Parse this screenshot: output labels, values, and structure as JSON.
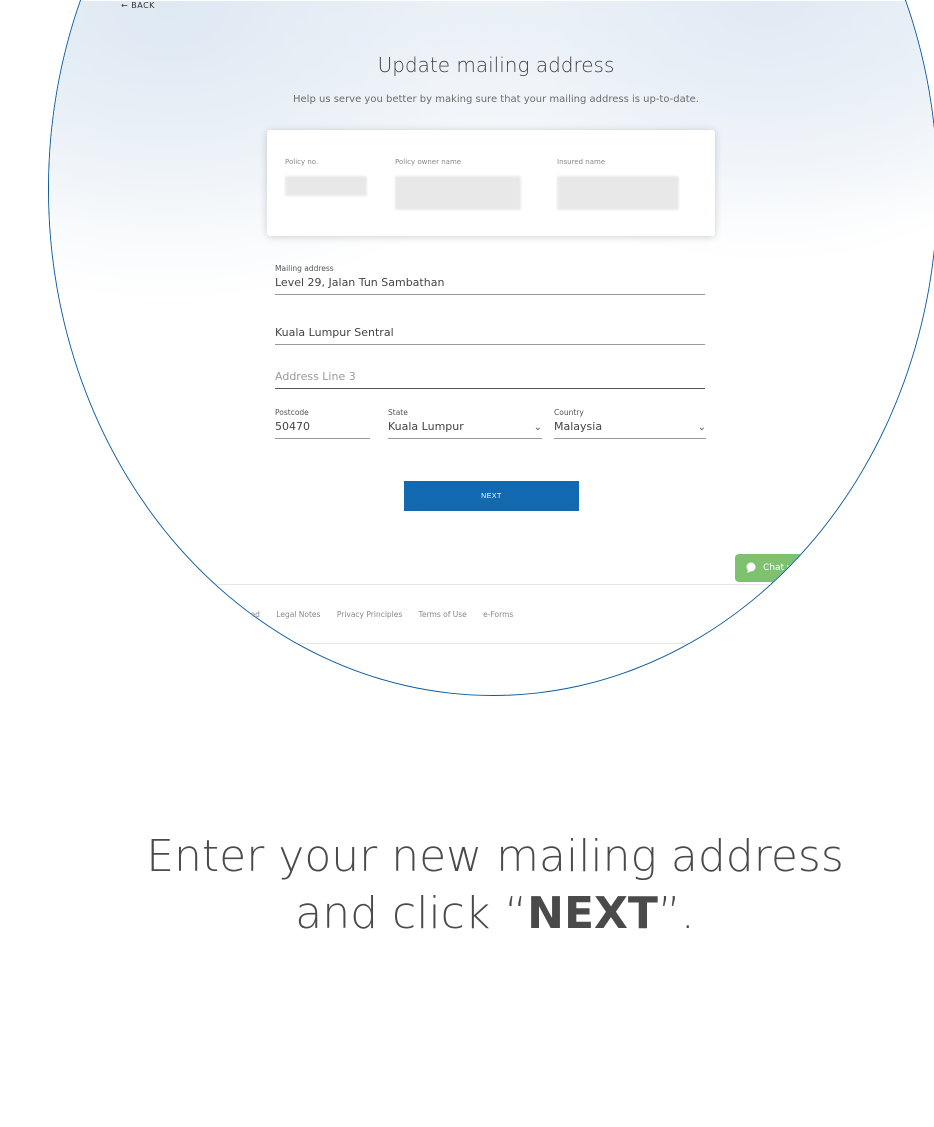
{
  "nav": {
    "back_label": "← BACK"
  },
  "form": {
    "title": "Update mailing address",
    "subtitle": "Help us serve you better by making sure that your mailing address is up-to-date.",
    "card": {
      "policy_no_label": "Policy no.",
      "owner_label": "Policy owner name",
      "insured_label": "Insured name"
    },
    "mailing_address_label": "Mailing address",
    "address_line1": "Level 29, Jalan Tun Sambathan",
    "address_line2": "Kuala Lumpur Sentral",
    "address_line3_placeholder": "Address Line 3",
    "postcode_label": "Postcode",
    "postcode_value": "50470",
    "state_label": "State",
    "state_value": "Kuala Lumpur",
    "country_label": "Country",
    "country_value": "Malaysia",
    "next_label": "NEXT"
  },
  "chat": {
    "label": "Chat w"
  },
  "footer": {
    "links": [
      "hts Reserved",
      "Legal Notes",
      "Privacy Principles",
      "Terms of Use",
      "e-Forms"
    ]
  },
  "caption": {
    "line1": "Enter your new mailing address",
    "line2_prefix": "and click “",
    "line2_bold": "NEXT",
    "line2_suffix": "”."
  },
  "colors": {
    "accent": "#1269b0",
    "zoom_ring": "#0a5aa0",
    "chat": "#7ec26f"
  },
  "icons": [
    "back-arrow-icon",
    "chevron-down-icon",
    "chat-icon"
  ]
}
